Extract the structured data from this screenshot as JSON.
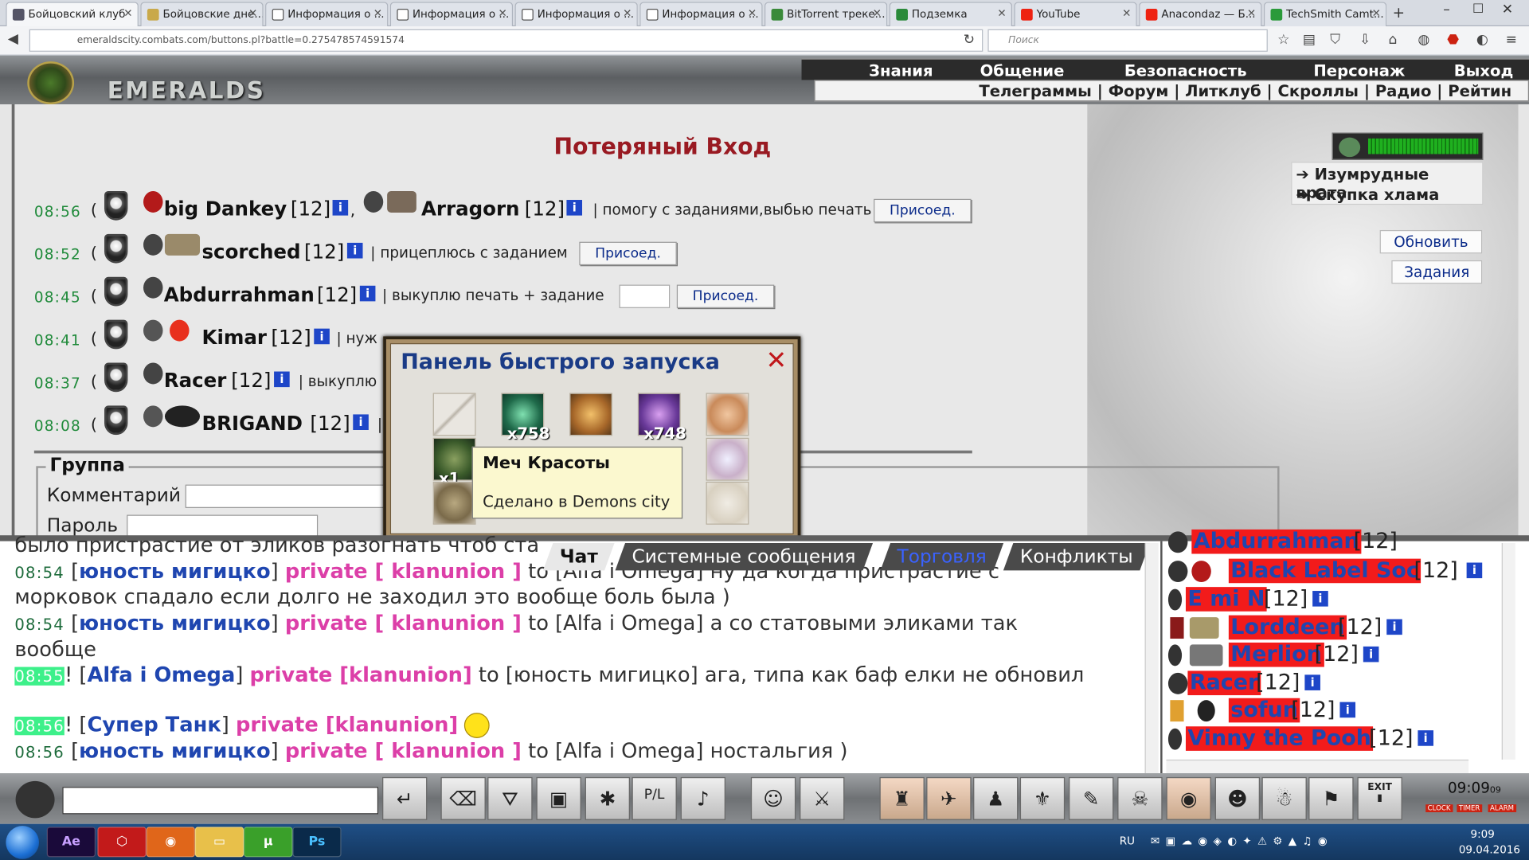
{
  "browser": {
    "tabs": [
      "Бойцовский клуб",
      "Бойцовские дне...",
      "Информация о ...",
      "Информация о ...",
      "Информация о ...",
      "Информация о ...",
      "BitTorrent треке...",
      "Подземка",
      "YouTube",
      "Anacondaz — Б...",
      "TechSmith Camt..."
    ],
    "url": "emeraldscity.combats.com/buttons.pl?battle=0.275478574591574",
    "search_placeholder": "Поиск"
  },
  "header": {
    "logo": "EMERALDS",
    "menu_top": [
      "Знания",
      "Общение",
      "Безопасность",
      "Персонаж",
      "Выход"
    ],
    "menu_bottom": "Телеграммы | Форум | Литклуб | Скроллы | Радио | Рейтин"
  },
  "page": {
    "title": "Потеряный Вход",
    "apps": [
      {
        "time": "08:56",
        "players": [
          {
            "nick": "big Dankey",
            "level": "[12]"
          },
          {
            "nick": "Arragorn",
            "level": "[12]"
          }
        ],
        "comment": "| помогу с заданиями,выбью печать",
        "join": "Присоед."
      },
      {
        "time": "08:52",
        "players": [
          {
            "nick": "scorched",
            "level": "[12]"
          }
        ],
        "comment": "| прицеплюсь с заданием",
        "join": "Присоед."
      },
      {
        "time": "08:45",
        "players": [
          {
            "nick": "Abdurrahman",
            "level": "[12]"
          }
        ],
        "comment": "| выкуплю печать + задание",
        "join": "Присоед."
      },
      {
        "time": "08:41",
        "players": [
          {
            "nick": "Kimar",
            "level": "[12]"
          }
        ],
        "comment": "| нуж"
      },
      {
        "time": "08:37",
        "players": [
          {
            "nick": "Racer",
            "level": "[12]"
          }
        ],
        "comment": "| выкуплю"
      },
      {
        "time": "08:08",
        "players": [
          {
            "nick": "BRIGAND",
            "level": "[12]"
          }
        ],
        "comment": "|"
      }
    ],
    "group": {
      "title": "Группа",
      "comment_label": "Комментарий",
      "password_label": "Пароль"
    },
    "side_links": [
      "Изумрудные врата",
      "Скупка хлама"
    ],
    "refresh": "Обновить",
    "tasks": "Задания"
  },
  "quick_panel": {
    "title": "Панель быстрого запуска",
    "counts": [
      "x758",
      "x748",
      "x1"
    ],
    "tooltip_title": "Меч Красоты",
    "tooltip_sub": "Сделано в Demons city"
  },
  "chat": {
    "tabs": [
      "Чат",
      "Системные сообщения",
      "Торговля",
      "Конфликты"
    ],
    "lines": [
      {
        "text": "было пристрастие от эликов разогнать чтоб ста"
      },
      {
        "time": "08:54",
        "nick": "юность мигицко",
        "priv": "private [ klanunion ]",
        "rest": "to [Alfa i Omega] ну да когда пристрастие с"
      },
      {
        "text": "морковок спадало если долго не заходил это вообще боль была )"
      },
      {
        "time": "08:54",
        "nick": "юность мигицко",
        "priv": "private [ klanunion ]",
        "rest": "to [Alfa i Omega] а со статовыми эликами так"
      },
      {
        "text": "вообще"
      },
      {
        "time": "08:55",
        "nick": "Alfa i Omega",
        "priv": "private [klanunion]",
        "rest": "to [юность мигицко] ага, типа как баф елки не обновил"
      },
      {
        "time": "08:56",
        "nick": "Супер Танк",
        "priv": "private [klanunion]",
        "rest": ""
      },
      {
        "time": "08:56",
        "nick": "юность мигицко",
        "priv": "private [ klanunion ]",
        "rest": "to [Alfa i Omega] ностальгия )"
      }
    ]
  },
  "users": [
    {
      "nick": "Abdurrahman",
      "level": "[12]"
    },
    {
      "nick": "Black Label Soc",
      "level": "[12]"
    },
    {
      "nick": "E mi N",
      "level": "[12]"
    },
    {
      "nick": "Lorddeen",
      "level": "[12]"
    },
    {
      "nick": "Merlion",
      "level": "[12]"
    },
    {
      "nick": "Racer",
      "level": "[12]"
    },
    {
      "nick": "sofun",
      "level": "[12]"
    },
    {
      "nick": "Vinny the Pooh",
      "level": "[12]"
    }
  ],
  "toolbar": {
    "exit": "EXIT",
    "clock": "09:09",
    "clock_sec": "09",
    "clock_label": "CLOCK",
    "timer_label": "TIMER",
    "alarm_label": "ALARM"
  },
  "taskbar": {
    "apps": [
      "Ae",
      "Ps"
    ],
    "lang": "RU",
    "time": "9:09",
    "date": "09.04.2016"
  }
}
